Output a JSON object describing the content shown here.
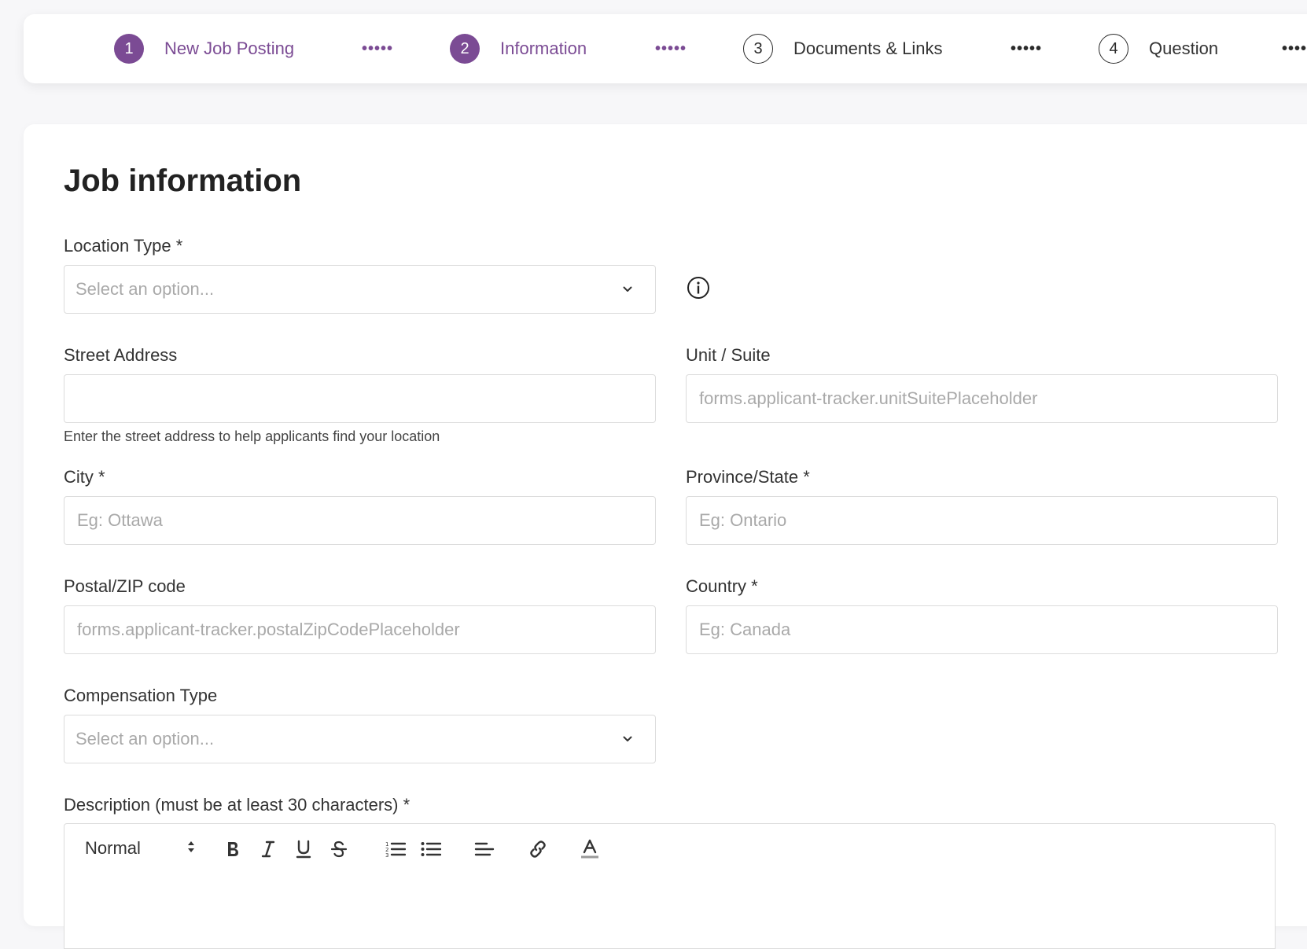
{
  "stepper": {
    "steps": [
      {
        "number": "1",
        "label": "New Job Posting",
        "state": "done"
      },
      {
        "number": "2",
        "label": "Information",
        "state": "active"
      },
      {
        "number": "3",
        "label": "Documents & Links",
        "state": "pending"
      },
      {
        "number": "4",
        "label": "Question",
        "state": "pending"
      }
    ],
    "separator": "•••••"
  },
  "form": {
    "title": "Job information",
    "location_type": {
      "label": "Location Type *",
      "value": "Select an option..."
    },
    "street_address": {
      "label": "Street Address",
      "value": "",
      "help": "Enter the street address to help applicants find your location"
    },
    "unit_suite": {
      "label": "Unit / Suite",
      "placeholder": "forms.applicant-tracker.unitSuitePlaceholder"
    },
    "city": {
      "label": "City *",
      "placeholder": "Eg: Ottawa"
    },
    "province_state": {
      "label": "Province/State *",
      "placeholder": "Eg: Ontario"
    },
    "postal_zip": {
      "label": "Postal/ZIP code",
      "placeholder": "forms.applicant-tracker.postalZipCodePlaceholder"
    },
    "country": {
      "label": "Country *",
      "placeholder": "Eg: Canada"
    },
    "compensation_type": {
      "label": "Compensation Type",
      "value": "Select an option..."
    },
    "description": {
      "label": "Description (must be at least 30 characters) *",
      "format": "Normal"
    }
  },
  "theme": {
    "accent": "#7b4b94",
    "border": "#dcdcdc",
    "placeholder": "#a9a9a9"
  },
  "icons": {
    "info": "info-circle-icon",
    "dropdown": "chevron-down-icon",
    "toolbar": [
      "bold-icon",
      "italic-icon",
      "underline-icon",
      "strikethrough-icon",
      "ordered-list-icon",
      "bullet-list-icon",
      "align-left-icon",
      "link-icon",
      "text-color-icon"
    ]
  }
}
